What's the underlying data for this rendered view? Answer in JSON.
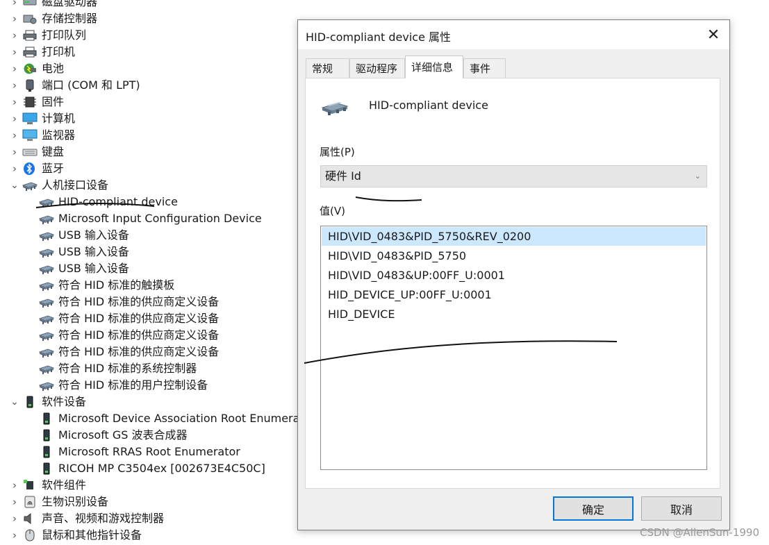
{
  "tree": {
    "items": [
      {
        "label": "磁盘驱动器",
        "level": 0,
        "expand": "collapsed",
        "icon": "disk-drive-icon"
      },
      {
        "label": "存储控制器",
        "level": 0,
        "expand": "collapsed",
        "icon": "storage-controller-icon"
      },
      {
        "label": "打印队列",
        "level": 0,
        "expand": "collapsed",
        "icon": "printer-icon"
      },
      {
        "label": "打印机",
        "level": 0,
        "expand": "collapsed",
        "icon": "printer-icon"
      },
      {
        "label": "电池",
        "level": 0,
        "expand": "collapsed",
        "icon": "battery-icon"
      },
      {
        "label": "端口 (COM 和 LPT)",
        "level": 0,
        "expand": "collapsed",
        "icon": "port-icon"
      },
      {
        "label": "固件",
        "level": 0,
        "expand": "collapsed",
        "icon": "firmware-icon"
      },
      {
        "label": "计算机",
        "level": 0,
        "expand": "collapsed",
        "icon": "computer-icon"
      },
      {
        "label": "监视器",
        "level": 0,
        "expand": "collapsed",
        "icon": "monitor-icon"
      },
      {
        "label": "键盘",
        "level": 0,
        "expand": "collapsed",
        "icon": "keyboard-icon"
      },
      {
        "label": "蓝牙",
        "level": 0,
        "expand": "collapsed",
        "icon": "bluetooth-icon"
      },
      {
        "label": "人机接口设备",
        "level": 0,
        "expand": "expanded",
        "icon": "hid-icon"
      },
      {
        "label": "HID-compliant device",
        "level": 1,
        "expand": "none",
        "icon": "hid-icon"
      },
      {
        "label": "Microsoft Input Configuration Device",
        "level": 1,
        "expand": "none",
        "icon": "hid-icon"
      },
      {
        "label": "USB 输入设备",
        "level": 1,
        "expand": "none",
        "icon": "hid-icon"
      },
      {
        "label": "USB 输入设备",
        "level": 1,
        "expand": "none",
        "icon": "hid-icon"
      },
      {
        "label": "USB 输入设备",
        "level": 1,
        "expand": "none",
        "icon": "hid-icon"
      },
      {
        "label": "符合 HID 标准的触摸板",
        "level": 1,
        "expand": "none",
        "icon": "hid-icon"
      },
      {
        "label": "符合 HID 标准的供应商定义设备",
        "level": 1,
        "expand": "none",
        "icon": "hid-icon"
      },
      {
        "label": "符合 HID 标准的供应商定义设备",
        "level": 1,
        "expand": "none",
        "icon": "hid-icon"
      },
      {
        "label": "符合 HID 标准的供应商定义设备",
        "level": 1,
        "expand": "none",
        "icon": "hid-icon"
      },
      {
        "label": "符合 HID 标准的供应商定义设备",
        "level": 1,
        "expand": "none",
        "icon": "hid-icon"
      },
      {
        "label": "符合 HID 标准的系统控制器",
        "level": 1,
        "expand": "none",
        "icon": "hid-icon"
      },
      {
        "label": "符合 HID 标准的用户控制设备",
        "level": 1,
        "expand": "none",
        "icon": "hid-icon"
      },
      {
        "label": "软件设备",
        "level": 0,
        "expand": "expanded",
        "icon": "software-device-icon"
      },
      {
        "label": "Microsoft Device Association Root Enumerator",
        "level": 1,
        "expand": "none",
        "icon": "software-device-icon"
      },
      {
        "label": "Microsoft GS 波表合成器",
        "level": 1,
        "expand": "none",
        "icon": "software-device-icon"
      },
      {
        "label": "Microsoft RRAS Root Enumerator",
        "level": 1,
        "expand": "none",
        "icon": "software-device-icon"
      },
      {
        "label": "RICOH MP C3504ex [002673E4C50C]",
        "level": 1,
        "expand": "none",
        "icon": "software-device-icon"
      },
      {
        "label": "软件组件",
        "level": 0,
        "expand": "collapsed",
        "icon": "software-component-icon"
      },
      {
        "label": "生物识别设备",
        "level": 0,
        "expand": "collapsed",
        "icon": "fingerprint-icon"
      },
      {
        "label": "声音、视频和游戏控制器",
        "level": 0,
        "expand": "collapsed",
        "icon": "speaker-icon"
      },
      {
        "label": "鼠标和其他指针设备",
        "level": 0,
        "expand": "collapsed",
        "icon": "mouse-icon"
      }
    ]
  },
  "dialog": {
    "title": "HID-compliant device 属性",
    "close_glyph": "✕",
    "tabs": [
      {
        "label": "常规",
        "active": false
      },
      {
        "label": "驱动程序",
        "active": false
      },
      {
        "label": "详细信息",
        "active": true
      },
      {
        "label": "事件",
        "active": false
      }
    ],
    "device_name": "HID-compliant device",
    "property_label": "属性(P)",
    "property_selected": "硬件 Id",
    "value_label": "值(V)",
    "values": [
      "HID\\VID_0483&PID_5750&REV_0200",
      "HID\\VID_0483&PID_5750",
      "HID\\VID_0483&UP:00FF_U:0001",
      "HID_DEVICE_UP:00FF_U:0001",
      "HID_DEVICE"
    ],
    "selected_value_index": 0,
    "ok_label": "确定",
    "cancel_label": "取消"
  },
  "watermark": "CSDN @AllenSun-1990",
  "colors": {
    "selection": "#cce8ff",
    "accent": "#0078d7",
    "bluetooth": "#1a73e8"
  }
}
